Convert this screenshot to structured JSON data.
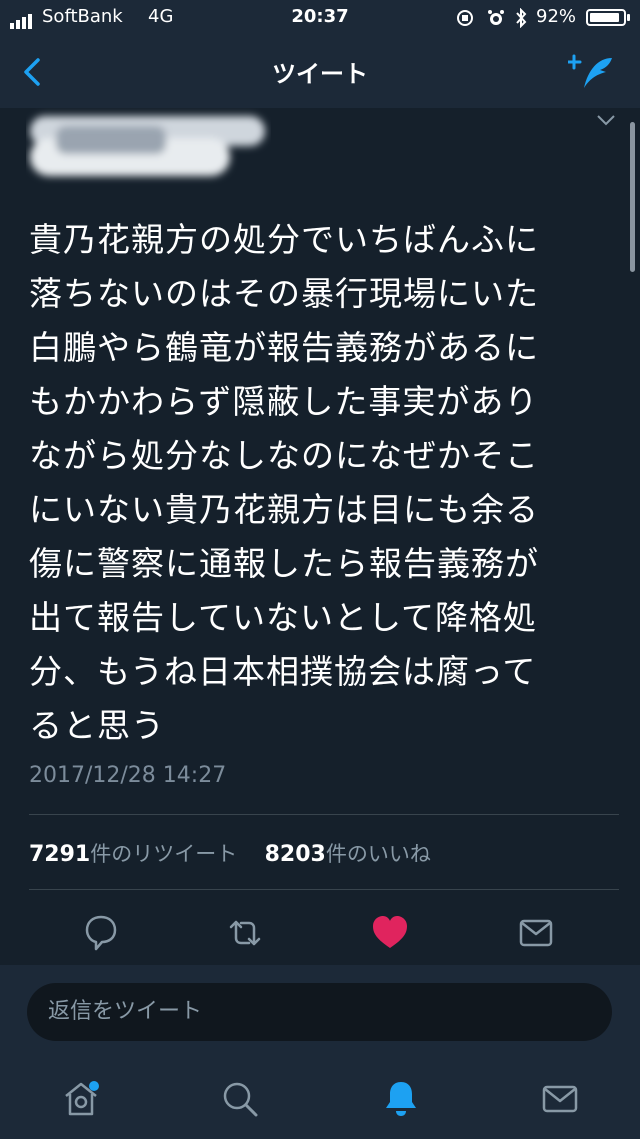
{
  "status_bar": {
    "carrier": "SoftBank",
    "network": "4G",
    "time": "20:37",
    "battery": "92%",
    "battery_level": 0.92
  },
  "nav": {
    "title": "ツイート"
  },
  "tweet": {
    "text": "貴乃花親方の処分でいちばんふに落ちないのはその暴行現場にいた白鵬やら鶴竜が報告義務があるにもかかわらず隠蔽した事実がありながら処分なしなのになぜかそこにいない貴乃花親方は目にも余る傷に警察に通報したら報告義務が出て報告していないとして降格処分、もうね日本相撲協会は腐ってると思う",
    "lines": [
      "貴乃花親方の処分でいちばんふに",
      "落ちないのはその暴行現場にいた",
      "白鵬やら鶴竜が報告義務があるに",
      "もかかわらず隠蔽した事実があり",
      "ながら処分なしなのになぜかそこ",
      "にいない貴乃花親方は目にも余る",
      "傷に警察に通報したら報告義務が",
      "出て報告していないとして降格処",
      "分、もうね日本相撲協会は腐って",
      "ると思う"
    ],
    "timestamp": "2017/12/28 14:27",
    "retweets": {
      "count": "7291",
      "label": "件のリツイート"
    },
    "likes": {
      "count": "8203",
      "label": "件のいいね"
    },
    "liked": true
  },
  "reply": {
    "placeholder": "返信をツイート"
  },
  "colors": {
    "accent": "#1da1f2",
    "like": "#e0245e",
    "background": "#15202b",
    "bar": "#1c2938",
    "muted": "#8899a6"
  },
  "icons": {
    "nav": [
      "back-chevron-icon",
      "compose-tweet-icon"
    ],
    "actions": [
      "reply-icon",
      "retweet-icon",
      "like-heart-icon",
      "direct-message-icon"
    ],
    "tabs": [
      "home-icon",
      "search-icon",
      "notifications-bell-icon",
      "messages-icon"
    ]
  }
}
